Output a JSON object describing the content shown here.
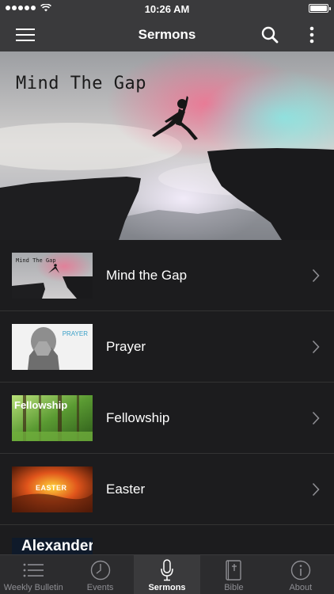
{
  "status_bar": {
    "time": "10:26 AM"
  },
  "nav": {
    "title": "Sermons"
  },
  "hero": {
    "title": "Mind The Gap"
  },
  "sermons": [
    {
      "label": "Mind the Gap",
      "thumb_text": "Mind The Gap"
    },
    {
      "label": "Prayer",
      "thumb_text": "PRAYER"
    },
    {
      "label": "Fellowship",
      "thumb_text": "Fellowship"
    },
    {
      "label": "Easter",
      "thumb_text": "EASTER"
    },
    {
      "label": "",
      "thumb_text": "Alexander"
    }
  ],
  "tabs": [
    {
      "label": "Weekly Bulletin",
      "icon": "list-icon"
    },
    {
      "label": "Events",
      "icon": "clock-icon"
    },
    {
      "label": "Sermons",
      "icon": "microphone-icon"
    },
    {
      "label": "Bible",
      "icon": "bible-icon"
    },
    {
      "label": "About",
      "icon": "info-icon"
    }
  ]
}
